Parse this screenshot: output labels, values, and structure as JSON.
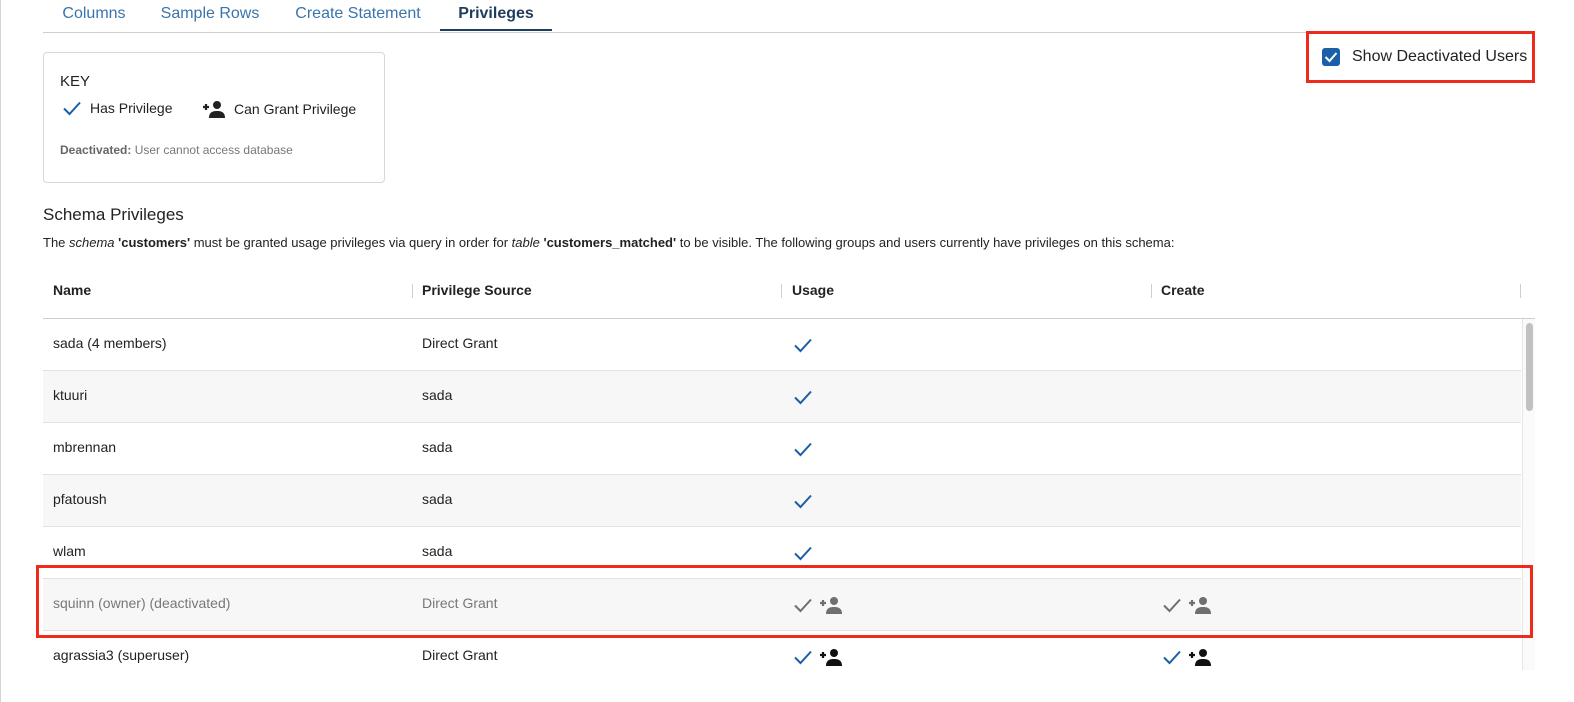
{
  "tabs": [
    {
      "label": "Columns",
      "active": false
    },
    {
      "label": "Sample Rows",
      "active": false
    },
    {
      "label": "Create Statement",
      "active": false
    },
    {
      "label": "Privileges",
      "active": true
    }
  ],
  "key": {
    "title": "KEY",
    "has_privilege": "Has Privilege",
    "can_grant": "Can Grant Privilege",
    "note_label": "Deactivated:",
    "note_text": " User cannot access database"
  },
  "show_deactivated": {
    "label": "Show Deactivated Users",
    "checked": true
  },
  "schema": {
    "title": "Schema Privileges",
    "desc_1": "The ",
    "desc_schema_word": "schema",
    "desc_schema_name": " 'customers'",
    "desc_2": " must be granted usage privileges via query in order for ",
    "desc_table_word": "table",
    "desc_table_name": " 'customers_matched'",
    "desc_3": " to be visible. The following groups and users currently have privileges on this schema:"
  },
  "table": {
    "headers": {
      "name": "Name",
      "source": "Privilege Source",
      "usage": "Usage",
      "create": "Create"
    },
    "rows": [
      {
        "name": "sada (4 members)",
        "source": "Direct Grant",
        "usage": "check",
        "create": "none",
        "deactivated": false
      },
      {
        "name": "ktuuri",
        "source": "sada",
        "usage": "check",
        "create": "none",
        "deactivated": false
      },
      {
        "name": "mbrennan",
        "source": "sada",
        "usage": "check",
        "create": "none",
        "deactivated": false
      },
      {
        "name": "pfatoush",
        "source": "sada",
        "usage": "check",
        "create": "none",
        "deactivated": false
      },
      {
        "name": "wlam",
        "source": "sada",
        "usage": "check",
        "create": "none",
        "deactivated": false
      },
      {
        "name": "squinn (owner) (deactivated)",
        "source": "Direct Grant",
        "usage": "check-grant",
        "create": "check-grant",
        "deactivated": true
      },
      {
        "name": "agrassia3 (superuser)",
        "source": "Direct Grant",
        "usage": "check-grant",
        "create": "check-grant",
        "deactivated": false
      }
    ]
  },
  "colors": {
    "accent": "#1a5fa8",
    "highlight": "#ee2a1b",
    "deactivated_icon": "#6f6f6f"
  }
}
